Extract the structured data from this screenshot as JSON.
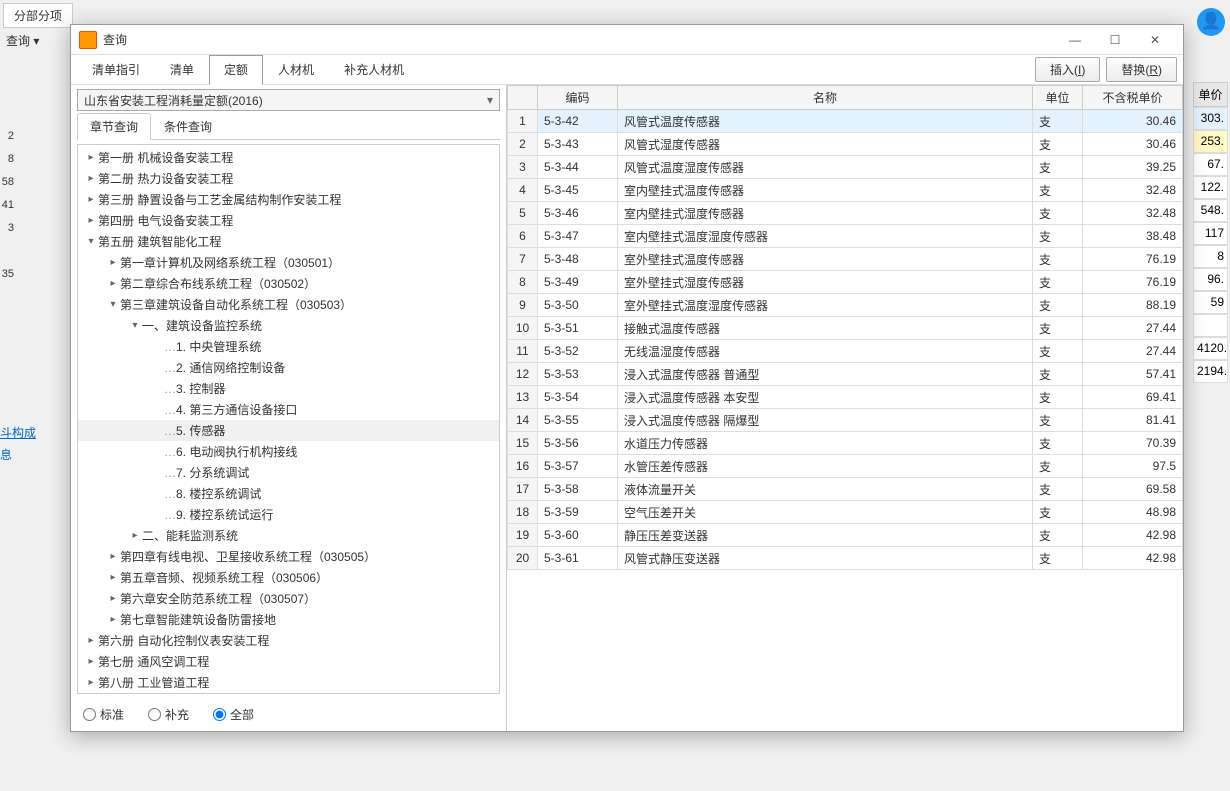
{
  "bg": {
    "tab": "分部分项",
    "dropdown": "查询",
    "price_header": "单价",
    "left_values": [
      "",
      "",
      "",
      "2",
      "8",
      "58",
      "41",
      "3",
      "",
      "35"
    ],
    "prices": [
      {
        "v": "303.",
        "cls": "hl1"
      },
      {
        "v": "253.",
        "cls": "hl2"
      },
      {
        "v": "67."
      },
      {
        "v": "122."
      },
      {
        "v": "548."
      },
      {
        "v": "117"
      },
      {
        "v": "8"
      },
      {
        "v": "96."
      },
      {
        "v": "59"
      },
      {
        "v": ""
      },
      {
        "v": "4120."
      },
      {
        "v": "2194."
      }
    ],
    "link1": "斗构成",
    "link2": "息"
  },
  "dialog": {
    "title": "查询",
    "tabs": [
      "清单指引",
      "清单",
      "定额",
      "人材机",
      "补充人材机"
    ],
    "active_tab": 2,
    "insert_btn": "插入",
    "insert_accel": "I",
    "replace_btn": "替换",
    "replace_accel": "R",
    "combo": "山东省安装工程消耗量定额(2016)",
    "subtabs": [
      "章节查询",
      "条件查询"
    ],
    "active_subtab": 0,
    "radios": [
      "标准",
      "补充",
      "全部"
    ],
    "radio_selected": 2
  },
  "tree": [
    {
      "d": 0,
      "t": "closed",
      "label": "第一册  机械设备安装工程"
    },
    {
      "d": 0,
      "t": "closed",
      "label": "第二册  热力设备安装工程"
    },
    {
      "d": 0,
      "t": "closed",
      "label": "第三册  静置设备与工艺金属结构制作安装工程"
    },
    {
      "d": 0,
      "t": "closed",
      "label": "第四册  电气设备安装工程"
    },
    {
      "d": 0,
      "t": "open",
      "label": "第五册  建筑智能化工程"
    },
    {
      "d": 1,
      "t": "closed",
      "label": "第一章计算机及网络系统工程（030501）"
    },
    {
      "d": 1,
      "t": "closed",
      "label": "第二章综合布线系统工程（030502）"
    },
    {
      "d": 1,
      "t": "open",
      "label": "第三章建筑设备自动化系统工程（030503）"
    },
    {
      "d": 2,
      "t": "open",
      "label": "一、建筑设备监控系统"
    },
    {
      "d": 3,
      "t": "none",
      "label": "1. 中央管理系统"
    },
    {
      "d": 3,
      "t": "none",
      "label": "2. 通信网络控制设备"
    },
    {
      "d": 3,
      "t": "none",
      "label": "3. 控制器"
    },
    {
      "d": 3,
      "t": "none",
      "label": "4. 第三方通信设备接口"
    },
    {
      "d": 3,
      "t": "none",
      "label": "5. 传感器",
      "sel": true
    },
    {
      "d": 3,
      "t": "none",
      "label": "6. 电动阀执行机构接线"
    },
    {
      "d": 3,
      "t": "none",
      "label": "7. 分系统调试"
    },
    {
      "d": 3,
      "t": "none",
      "label": "8. 楼控系统调试"
    },
    {
      "d": 3,
      "t": "none",
      "label": "9. 楼控系统试运行"
    },
    {
      "d": 2,
      "t": "closed",
      "label": "二、能耗监测系统"
    },
    {
      "d": 1,
      "t": "closed",
      "label": "第四章有线电视、卫星接收系统工程（030505）"
    },
    {
      "d": 1,
      "t": "closed",
      "label": "第五章音频、视频系统工程（030506）"
    },
    {
      "d": 1,
      "t": "closed",
      "label": "第六章安全防范系统工程（030507）"
    },
    {
      "d": 1,
      "t": "closed",
      "label": "第七章智能建筑设备防雷接地"
    },
    {
      "d": 0,
      "t": "closed",
      "label": "第六册  自动化控制仪表安装工程"
    },
    {
      "d": 0,
      "t": "closed",
      "label": "第七册  通风空调工程"
    },
    {
      "d": 0,
      "t": "closed",
      "label": "第八册  工业管道工程"
    }
  ],
  "grid": {
    "headers": {
      "code": "编码",
      "name": "名称",
      "unit": "单位",
      "price": "不含税单价"
    },
    "rows": [
      {
        "code": "5-3-42",
        "name": "风管式温度传感器",
        "unit": "支",
        "price": "30.46",
        "sel": true
      },
      {
        "code": "5-3-43",
        "name": "风管式湿度传感器",
        "unit": "支",
        "price": "30.46"
      },
      {
        "code": "5-3-44",
        "name": "风管式温度湿度传感器",
        "unit": "支",
        "price": "39.25"
      },
      {
        "code": "5-3-45",
        "name": "室内壁挂式温度传感器",
        "unit": "支",
        "price": "32.48"
      },
      {
        "code": "5-3-46",
        "name": "室内壁挂式湿度传感器",
        "unit": "支",
        "price": "32.48"
      },
      {
        "code": "5-3-47",
        "name": "室内壁挂式温度湿度传感器",
        "unit": "支",
        "price": "38.48"
      },
      {
        "code": "5-3-48",
        "name": "室外壁挂式温度传感器",
        "unit": "支",
        "price": "76.19"
      },
      {
        "code": "5-3-49",
        "name": "室外壁挂式湿度传感器",
        "unit": "支",
        "price": "76.19"
      },
      {
        "code": "5-3-50",
        "name": "室外壁挂式温度湿度传感器",
        "unit": "支",
        "price": "88.19"
      },
      {
        "code": "5-3-51",
        "name": "接触式温度传感器",
        "unit": "支",
        "price": "27.44"
      },
      {
        "code": "5-3-52",
        "name": "无线温湿度传感器",
        "unit": "支",
        "price": "27.44"
      },
      {
        "code": "5-3-53",
        "name": "浸入式温度传感器  普通型",
        "unit": "支",
        "price": "57.41"
      },
      {
        "code": "5-3-54",
        "name": "浸入式温度传感器  本安型",
        "unit": "支",
        "price": "69.41"
      },
      {
        "code": "5-3-55",
        "name": "浸入式温度传感器  隔爆型",
        "unit": "支",
        "price": "81.41"
      },
      {
        "code": "5-3-56",
        "name": "水道压力传感器",
        "unit": "支",
        "price": "70.39"
      },
      {
        "code": "5-3-57",
        "name": "水管压差传感器",
        "unit": "支",
        "price": "97.5"
      },
      {
        "code": "5-3-58",
        "name": "液体流量开关",
        "unit": "支",
        "price": "69.58"
      },
      {
        "code": "5-3-59",
        "name": "空气压差开关",
        "unit": "支",
        "price": "48.98"
      },
      {
        "code": "5-3-60",
        "name": "静压压差变送器",
        "unit": "支",
        "price": "42.98"
      },
      {
        "code": "5-3-61",
        "name": "风管式静压变送器",
        "unit": "支",
        "price": "42.98"
      }
    ]
  }
}
